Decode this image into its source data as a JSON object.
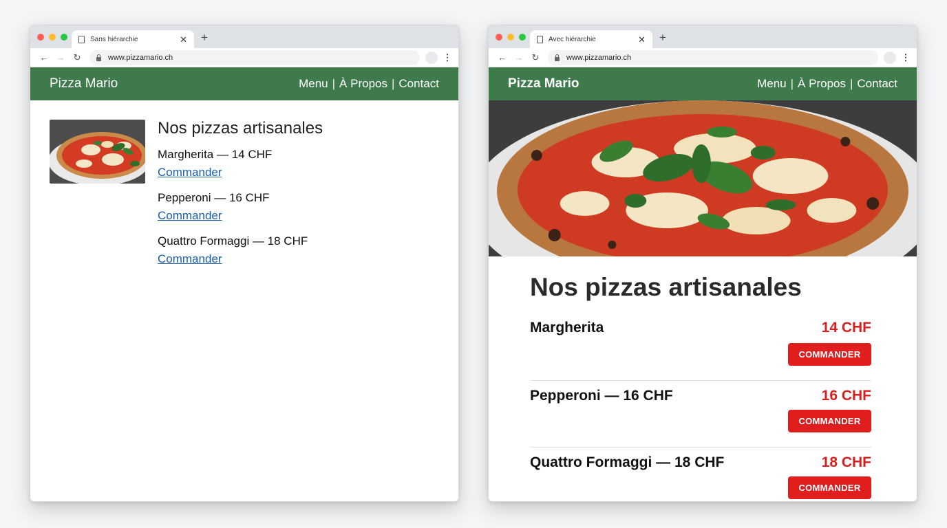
{
  "left_window": {
    "tab_title": "Sans hiérarchie",
    "url": "www.pizzamario.ch",
    "brand": "Pizza Mario",
    "nav": [
      "Menu",
      "À Propos",
      "Contact"
    ],
    "nav_separator": "|",
    "heading": "Nos pizzas artisanales",
    "items": [
      {
        "name": "Margherita — 14 CHF",
        "link": "Commander"
      },
      {
        "name": "Pepperoni — 16 CHF",
        "link": "Commander"
      },
      {
        "name": "Quattro Formaggi — 18 CHF",
        "link": "Commander"
      }
    ]
  },
  "right_window": {
    "tab_title": "Avec hiérarchie",
    "url": "www.pizzamario.ch",
    "brand": "Pizza Mario",
    "nav": [
      "Menu",
      "À Propos",
      "Contact"
    ],
    "nav_separator": "|",
    "heading": "Nos pizzas artisanales",
    "items": [
      {
        "name": "Margherita",
        "price": "14 CHF",
        "button": "COMMANDER"
      },
      {
        "name": "Pepperoni — 16 CHF",
        "price": "16 CHF",
        "button": "COMMANDER"
      },
      {
        "name": "Quattro Formaggi — 18 CHF",
        "price": "18 CHF",
        "button": "COMMANDER"
      }
    ]
  },
  "colors": {
    "header_green": "#3e7a4c",
    "link_blue": "#1a5ea8",
    "accent_red": "#e11e1e",
    "price_red": "#d7201e"
  },
  "icons": [
    "document-icon",
    "close-icon",
    "new-tab-icon",
    "back-arrow-icon",
    "forward-arrow-icon",
    "reload-icon",
    "lock-icon",
    "profile-icon",
    "kebab-menu-icon",
    "pizza-image"
  ]
}
